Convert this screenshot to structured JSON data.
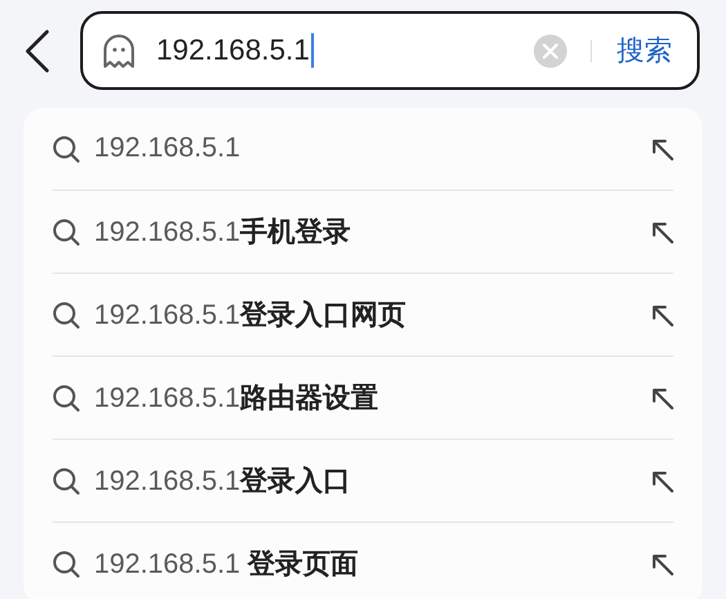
{
  "search": {
    "value": "192.168.5.1",
    "button": "搜索"
  },
  "suggestions": [
    {
      "text": "192.168.5.1"
    },
    {
      "text": "192.168.5.1**手机登录**"
    },
    {
      "text": "192.168.5.1**登录入口网页**"
    },
    {
      "text": "192.168.5.1**路由器设置**"
    },
    {
      "text": "192.168.5.1**登录入口**"
    },
    {
      "text": "192.168.5.1 **登录页面**"
    }
  ]
}
